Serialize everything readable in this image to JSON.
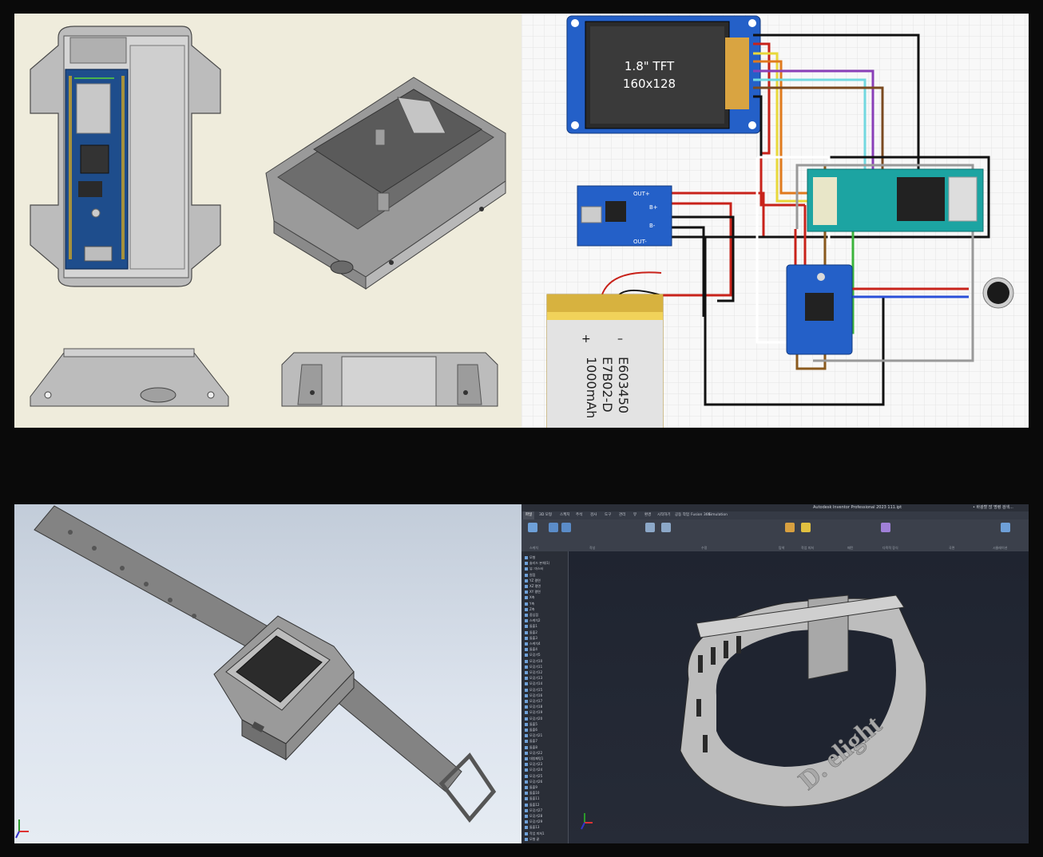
{
  "schematic": {
    "tft_line1": "1.8\" TFT",
    "tft_line2": "160x128",
    "battery_line1": "E603450",
    "battery_line2": "E7B02-D",
    "battery_line3": "1000mAh",
    "battery_plus": "+",
    "battery_minus": "–",
    "charger_out_plus": "OUT+",
    "charger_b_plus": "B+",
    "charger_b_minus": "B-",
    "charger_out_minus": "OUT-"
  },
  "inventor": {
    "title": "Autodesk Inventor Professional 2023   111.ipt",
    "search": "• 바광할 많 명령 검색...",
    "tabs": [
      "파일",
      "3D 모형",
      "스케치",
      "주석",
      "검사",
      "도구",
      "관리",
      "뷰",
      "환경",
      "시작하기",
      "공동 작업",
      "Fusion 360",
      "Simulation"
    ],
    "groups": [
      "스케치",
      "작성",
      "수정",
      "탐색",
      "작업 피쳐",
      "패턴",
      "다목적 장식",
      "곡면",
      "시뮬레이션"
    ],
    "brand": "D. elight",
    "tree": [
      "모형",
      "솔리드 본체(1)",
      "뷰: 마스터",
      "원점",
      "YZ 평면",
      "XZ 평면",
      "XY 평면",
      "X축",
      "Y축",
      "Z축",
      "중심점",
      "스케치2",
      "돌출1",
      "돌출2",
      "돌출3",
      "스케치4",
      "돌출4",
      "모깃기5",
      "모깃기10",
      "모깃기11",
      "모깃기12",
      "모깃기13",
      "모깃기14",
      "모깃기15",
      "모깃기16",
      "모깃기17",
      "모깃기18",
      "모깃기19",
      "모깃기20",
      "돌출5",
      "돌출6",
      "모깃기21",
      "돌출7",
      "돌출8",
      "모깃기22",
      "대칭패턳1",
      "모깃기23",
      "모깃기24",
      "모깃기25",
      "모깃기26",
      "돌출9",
      "돌출10",
      "돌출11",
      "돌출12",
      "모깃기27",
      "모깃기28",
      "모깃기29",
      "돌출13",
      "작업 피쳐1",
      "모형 끝"
    ],
    "colors": {
      "titlebar": "#2b2f38",
      "ribbon": "#3b404b",
      "viewport": "#1f2430",
      "accent": "#e0443a"
    }
  }
}
